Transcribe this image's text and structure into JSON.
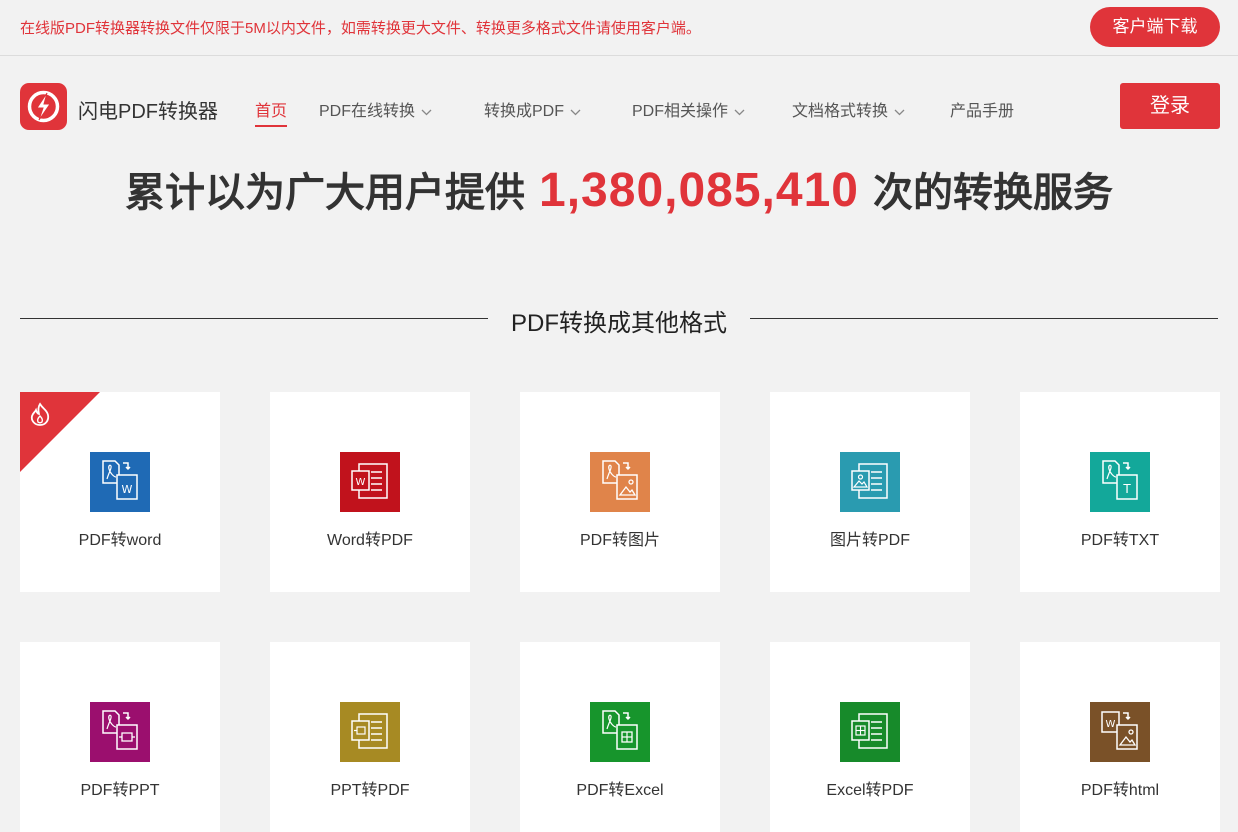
{
  "topbar": {
    "notice": "在线版PDF转换器转换文件仅限于5M以内文件，如需转换更大文件、转换更多格式文件请使用客户端。",
    "download_button": "客户端下载"
  },
  "nav": {
    "logo_text": "闪电PDF转换器",
    "items": [
      {
        "label": "首页",
        "dropdown": false
      },
      {
        "label": "PDF在线转换",
        "dropdown": true
      },
      {
        "label": "转换成PDF",
        "dropdown": true
      },
      {
        "label": "PDF相关操作",
        "dropdown": true
      },
      {
        "label": "文档格式转换",
        "dropdown": true
      },
      {
        "label": "产品手册",
        "dropdown": false
      }
    ],
    "login": "登录"
  },
  "counter": {
    "prefix": "累计以为广大用户提供",
    "number": "1,380,085,410",
    "suffix": "次的转换服务"
  },
  "section": {
    "title": "PDF转换成其他格式"
  },
  "tools": [
    {
      "label": "PDF转word",
      "icon": "pdf-to-word-icon",
      "color": "#1f6ab5",
      "hot": true
    },
    {
      "label": "Word转PDF",
      "icon": "word-to-pdf-icon",
      "color": "#c1121c",
      "hot": false
    },
    {
      "label": "PDF转图片",
      "icon": "pdf-to-image-icon",
      "color": "#e0844a",
      "hot": false
    },
    {
      "label": "图片转PDF",
      "icon": "image-to-pdf-icon",
      "color": "#2a9bb0",
      "hot": false
    },
    {
      "label": "PDF转TXT",
      "icon": "pdf-to-txt-icon",
      "color": "#13a89a",
      "hot": false
    },
    {
      "label": "PDF转PPT",
      "icon": "pdf-to-ppt-icon",
      "color": "#9b0f6e",
      "hot": false
    },
    {
      "label": "PPT转PDF",
      "icon": "ppt-to-pdf-icon",
      "color": "#a78a23",
      "hot": false
    },
    {
      "label": "PDF转Excel",
      "icon": "pdf-to-excel-icon",
      "color": "#17952c",
      "hot": false
    },
    {
      "label": "Excel转PDF",
      "icon": "excel-to-pdf-icon",
      "color": "#178a2a",
      "hot": false
    },
    {
      "label": "PDF转html",
      "icon": "pdf-to-html-icon",
      "color": "#7a5128",
      "hot": false
    }
  ],
  "colors": {
    "accent": "#e0343a",
    "background": "#f2f2f2"
  }
}
